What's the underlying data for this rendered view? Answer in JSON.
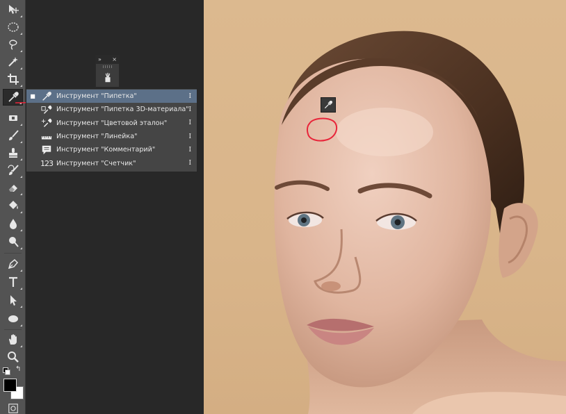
{
  "mini_panel": {
    "collapse_glyph": "»",
    "close_glyph": "×"
  },
  "flyout": {
    "items": [
      {
        "label": "Инструмент \"Пипетка\"",
        "shortcut": "I",
        "selected": true,
        "icon": "eyedropper-icon"
      },
      {
        "label": "Инструмент \"Пипетка 3D-материала\"",
        "shortcut": "I",
        "selected": false,
        "icon": "3d-material-eyedropper-icon"
      },
      {
        "label": "Инструмент \"Цветовой эталон\"",
        "shortcut": "I",
        "selected": false,
        "icon": "color-sampler-icon"
      },
      {
        "label": "Инструмент \"Линейка\"",
        "shortcut": "I",
        "selected": false,
        "icon": "ruler-icon"
      },
      {
        "label": "Инструмент \"Комментарий\"",
        "shortcut": "I",
        "selected": false,
        "icon": "note-icon"
      },
      {
        "label": "Инструмент \"Счетчик\"",
        "shortcut": "I",
        "selected": false,
        "icon": "count-icon"
      }
    ],
    "selected_marker": "■",
    "count_icon_text": "123"
  },
  "colors": {
    "panel_bg": "#535353",
    "menu_bg": "#454545",
    "selection": "#5c7088",
    "annotation_red": "#e8253a",
    "canvas_bg": "#282828",
    "photo_backdrop": "#dcb98f"
  }
}
